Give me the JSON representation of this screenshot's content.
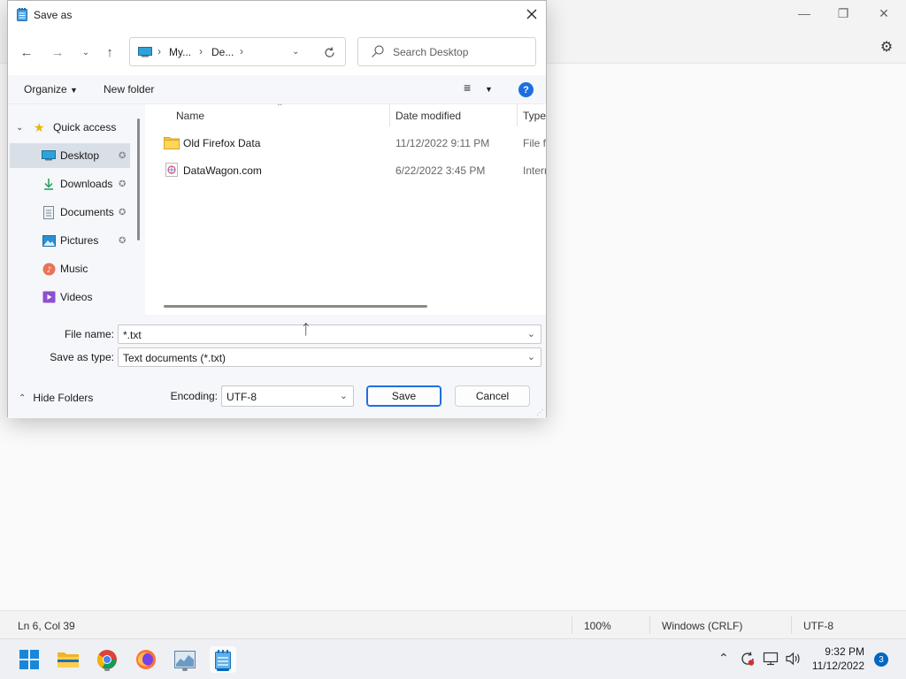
{
  "notepad": {
    "status": {
      "position": "Ln 6, Col 39",
      "zoom": "100%",
      "line_endings": "Windows (CRLF)",
      "encoding": "UTF-8"
    }
  },
  "dialog": {
    "title": "Save as",
    "address": {
      "seg1": "My...",
      "seg2": "De..."
    },
    "search_placeholder": "Search Desktop",
    "commands": {
      "organize": "Organize",
      "new_folder": "New folder"
    },
    "nav": {
      "quick_access": "Quick access",
      "items": [
        {
          "label": "Desktop",
          "icon": "desktop-icon"
        },
        {
          "label": "Downloads",
          "icon": "downloads-icon"
        },
        {
          "label": "Documents",
          "icon": "documents-icon"
        },
        {
          "label": "Pictures",
          "icon": "pictures-icon"
        },
        {
          "label": "Music",
          "icon": "music-icon"
        },
        {
          "label": "Videos",
          "icon": "videos-icon"
        }
      ]
    },
    "columns": {
      "name": "Name",
      "date": "Date modified",
      "type": "Type"
    },
    "files": [
      {
        "name": "Old Firefox Data",
        "date": "11/12/2022 9:11 PM",
        "type": "File fo",
        "icon": "folder-icon"
      },
      {
        "name": "DataWagon.com",
        "date": "6/22/2022 3:45 PM",
        "type": "Intern",
        "icon": "internet-shortcut-icon"
      }
    ],
    "file_name_label": "File name:",
    "file_name_value": "*.txt",
    "save_type_label": "Save as type:",
    "save_type_value": "Text documents (*.txt)",
    "encoding_label": "Encoding:",
    "encoding_value": "UTF-8",
    "save_label": "Save",
    "cancel_label": "Cancel",
    "hide_folders_label": "Hide Folders"
  },
  "taskbar": {
    "time": "9:32 PM",
    "date": "11/12/2022",
    "notifications": "3"
  }
}
